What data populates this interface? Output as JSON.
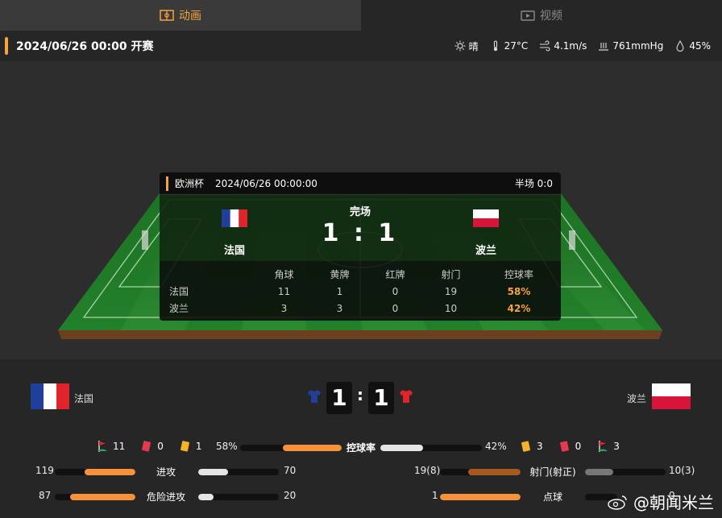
{
  "tabs": {
    "animation": "动画",
    "video": "视频"
  },
  "header": {
    "kickoff": "2024/06/26 00:00 开赛"
  },
  "weather": {
    "condition": "晴",
    "temp": "27°C",
    "wind": "4.1m/s",
    "pressure": "761mmHg",
    "humidity": "45%"
  },
  "overlay": {
    "competition": "欧洲杯",
    "datetime": "2024/06/26 00:00:00",
    "halftime": "半场 0:0",
    "status": "完场",
    "score": "1 : 1",
    "home": "法国",
    "away": "波兰",
    "columns": [
      "角球",
      "黄牌",
      "红牌",
      "射门",
      "控球率"
    ],
    "rows": [
      {
        "team": "法国",
        "corners": "11",
        "yellow": "1",
        "red": "0",
        "shots": "19",
        "possession": "58%"
      },
      {
        "team": "波兰",
        "corners": "3",
        "yellow": "3",
        "red": "0",
        "shots": "10",
        "possession": "42%"
      }
    ]
  },
  "scoreboard": {
    "home": "法国",
    "away": "波兰",
    "home_score": "1",
    "away_score": "1",
    "colon": ":"
  },
  "events": {
    "home_corners": "11",
    "home_red": "0",
    "home_yellow": "1",
    "home_possession": "58%",
    "possession_label": "控球率",
    "away_possession": "42%",
    "away_yellow": "3",
    "away_red": "0",
    "away_corners": "3"
  },
  "stats": {
    "attack": {
      "label": "进攻",
      "home": "119",
      "away": "70",
      "home_frac": 0.63,
      "away_frac": 0.37
    },
    "danger": {
      "label": "危险进攻",
      "home": "87",
      "away": "20",
      "home_frac": 0.81,
      "away_frac": 0.19
    },
    "shots": {
      "label": "射门(射正)",
      "home": "19(8)",
      "away": "10(3)",
      "home_frac": 0.65,
      "away_frac": 0.35
    },
    "penalty": {
      "label": "点球",
      "home": "1",
      "away": "0",
      "home_frac": 1.0,
      "away_frac": 0.0
    }
  },
  "watermark": "@朝闻米兰",
  "colors": {
    "accent": "#f7a33a",
    "france_blue": "#1f3f9a",
    "france_red": "#e1242c",
    "poland_red": "#d8143a"
  }
}
